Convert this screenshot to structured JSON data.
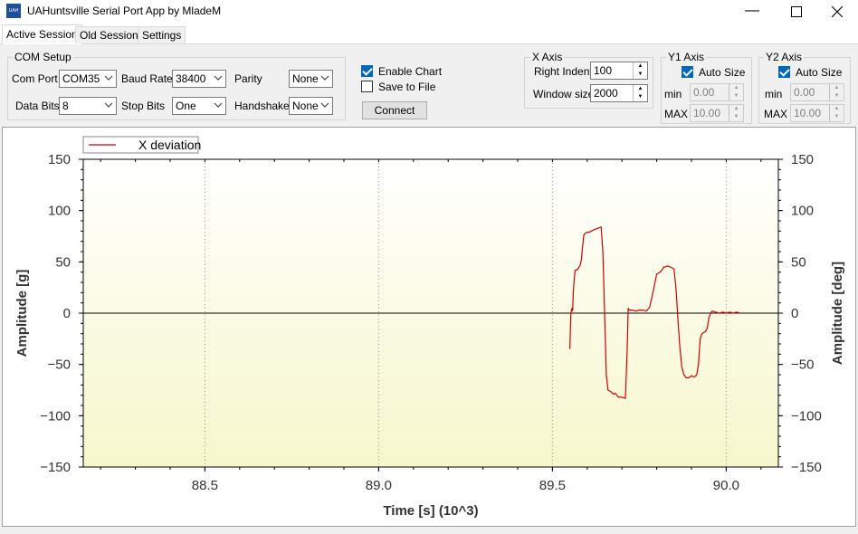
{
  "window": {
    "title": "UAHuntsville Serial Port App by MladeM",
    "icon_text": "UAH"
  },
  "tabs": [
    {
      "label": "Active Session",
      "active": true
    },
    {
      "label": "Old Session",
      "active": false
    },
    {
      "label": "Settings",
      "active": false
    }
  ],
  "com_setup": {
    "title": "COM Setup",
    "com_port": {
      "label": "Com Port",
      "value": "COM35"
    },
    "baud_rate": {
      "label": "Baud Rate",
      "value": "38400"
    },
    "parity": {
      "label": "Parity",
      "value": "None"
    },
    "data_bits": {
      "label": "Data Bits",
      "value": "8"
    },
    "stop_bits": {
      "label": "Stop Bits",
      "value": "One"
    },
    "handshake": {
      "label": "Handshake",
      "value": "None"
    }
  },
  "options": {
    "enable_chart": {
      "label": "Enable Chart",
      "checked": true
    },
    "save_to_file": {
      "label": "Save to File",
      "checked": false
    },
    "connect_label": "Connect"
  },
  "x_axis": {
    "title": "X Axis",
    "right_indent": {
      "label": "Right Indent",
      "value": "100"
    },
    "window_size": {
      "label": "Window size",
      "value": "2000"
    }
  },
  "y1_axis": {
    "title": "Y1 Axis",
    "auto_size": {
      "label": "Auto Size",
      "checked": true
    },
    "min": {
      "label": "min",
      "value": "0.00"
    },
    "max": {
      "label": "MAX",
      "value": "10.00"
    }
  },
  "y2_axis": {
    "title": "Y2 Axis",
    "auto_size": {
      "label": "Auto Size",
      "checked": true
    },
    "min": {
      "label": "min",
      "value": "0.00"
    },
    "max": {
      "label": "MAX",
      "value": "10.00"
    }
  },
  "colors": {
    "series": "#d40000",
    "plot_gradient_top": "#ffffff",
    "plot_gradient_bottom": "#f7f7cc",
    "accent": "#0067c0"
  },
  "chart_data": {
    "type": "line",
    "xlabel": "Time [s] (10^3)",
    "ylabel": "Amplitude [g]",
    "y2label": "Amplitude [deg]",
    "xlim": [
      88.15,
      90.15
    ],
    "ylim": [
      -150,
      150
    ],
    "y2lim": [
      -150,
      150
    ],
    "x_ticks": [
      88.5,
      89.0,
      89.5,
      90.0
    ],
    "x_tick_labels": [
      "88.5",
      "89.0",
      "89.5",
      "90.0"
    ],
    "y_ticks": [
      -150,
      -100,
      -50,
      0,
      50,
      100,
      150
    ],
    "y_tick_labels": [
      "−150",
      "−100",
      "−50",
      "0",
      "50",
      "100",
      "150"
    ],
    "grid": "vertical dotted",
    "legend_position": "top-left",
    "series": [
      {
        "name": "X deviation",
        "x": [
          89.55,
          89.552,
          89.553,
          89.556,
          89.558,
          89.56,
          89.563,
          89.566,
          89.57,
          89.575,
          89.58,
          89.583,
          89.586,
          89.59,
          89.595,
          89.6,
          89.606,
          89.612,
          89.618,
          89.625,
          89.632,
          89.64,
          89.645,
          89.65,
          89.655,
          89.66,
          89.665,
          89.67,
          89.675,
          89.68,
          89.69,
          89.7,
          89.71,
          89.715,
          89.718,
          89.72,
          89.73,
          89.74,
          89.75,
          89.76,
          89.77,
          89.78,
          89.79,
          89.8,
          89.81,
          89.815,
          89.82,
          89.825,
          89.83,
          89.84,
          89.85,
          89.856,
          89.86,
          89.866,
          89.872,
          89.878,
          89.885,
          89.892,
          89.9,
          89.905,
          89.91,
          89.915,
          89.92,
          89.925,
          89.93,
          89.935,
          89.94,
          89.945,
          89.95,
          89.955,
          89.96,
          89.97,
          89.98,
          89.99,
          90.0,
          90.01,
          90.02,
          90.03,
          90.04
        ],
        "values": [
          -35,
          -10,
          0,
          5,
          2,
          20,
          35,
          42,
          42,
          44,
          47,
          52,
          62,
          76,
          78,
          79,
          79,
          80,
          81,
          82,
          83,
          84,
          60,
          0,
          -60,
          -75,
          -76,
          -77,
          -79,
          -78,
          -82,
          -82,
          -83,
          -35,
          5,
          3,
          3,
          2,
          3,
          3,
          2,
          6,
          22,
          38,
          40,
          42,
          45,
          45,
          46,
          45,
          43,
          22,
          0,
          -30,
          -52,
          -60,
          -63,
          -63,
          -61,
          -62,
          -62,
          -60,
          -50,
          -25,
          -20,
          -19,
          -18,
          -15,
          -5,
          0,
          2,
          1,
          0,
          1,
          0,
          1,
          0,
          1,
          0
        ]
      }
    ]
  }
}
